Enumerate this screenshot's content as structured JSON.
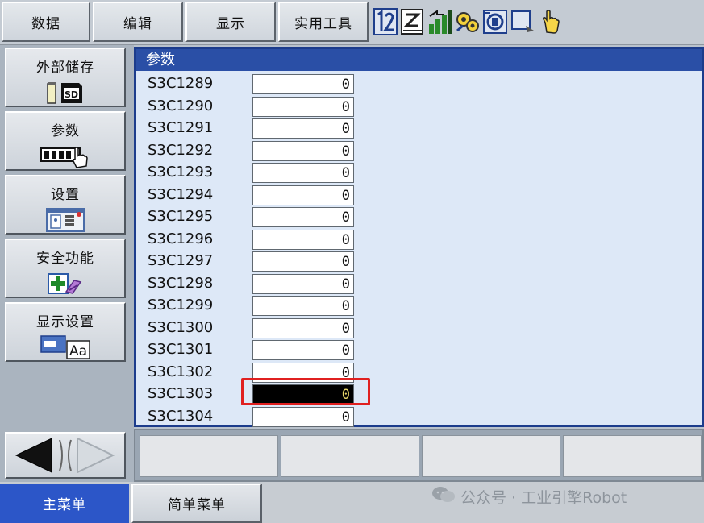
{
  "menu": {
    "data_label": "数据",
    "edit_label": "编辑",
    "display_label": "显示",
    "utility_label": "实用工具"
  },
  "status_icons": [
    "axis-toggle-icon",
    "edit-mode-icon",
    "speed-signal-icon",
    "gears-icon",
    "servo-icon",
    "monitor-icon",
    "hand-icon"
  ],
  "sidebar": {
    "items": [
      {
        "label": "外部储存",
        "icon": "sd-card-icon"
      },
      {
        "label": "参数",
        "icon": "parameter-keys-icon"
      },
      {
        "label": "设置",
        "icon": "setup-panel-icon"
      },
      {
        "label": "安全功能",
        "icon": "safety-cross-icon"
      },
      {
        "label": "显示设置",
        "icon": "font-display-icon"
      }
    ]
  },
  "param_window": {
    "title": "参数",
    "rows": [
      {
        "name": "S3C1289",
        "value": "0"
      },
      {
        "name": "S3C1290",
        "value": "0"
      },
      {
        "name": "S3C1291",
        "value": "0"
      },
      {
        "name": "S3C1292",
        "value": "0"
      },
      {
        "name": "S3C1293",
        "value": "0"
      },
      {
        "name": "S3C1294",
        "value": "0"
      },
      {
        "name": "S3C1295",
        "value": "0"
      },
      {
        "name": "S3C1296",
        "value": "0"
      },
      {
        "name": "S3C1297",
        "value": "0"
      },
      {
        "name": "S3C1298",
        "value": "0"
      },
      {
        "name": "S3C1299",
        "value": "0"
      },
      {
        "name": "S3C1300",
        "value": "0"
      },
      {
        "name": "S3C1301",
        "value": "0"
      },
      {
        "name": "S3C1302",
        "value": "0"
      },
      {
        "name": "S3C1303",
        "value": "0",
        "selected": true
      },
      {
        "name": "S3C1304",
        "value": "0"
      }
    ]
  },
  "bottom": {
    "main_menu_label": "主菜单",
    "simple_menu_label": "简单菜单"
  },
  "watermark": {
    "text": "公众号 · 工业引擎Robot"
  },
  "colors": {
    "accent": "#2c56c8",
    "title_bar": "#2a4fa6",
    "highlight": "#e02020",
    "selected_value_text": "#e8d76a"
  }
}
